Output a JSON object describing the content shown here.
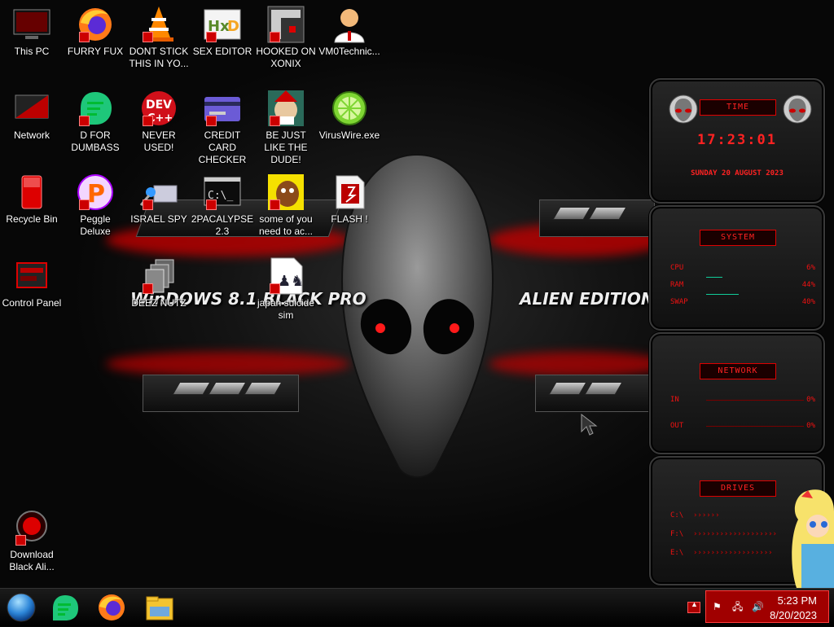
{
  "wallpaper": {
    "left_text": "WinDOWS 8.1 BLACK PRO",
    "right_text": "ALIEN EDITION 20"
  },
  "desktop_icons": [
    {
      "label": "This PC",
      "icon": "computer-icon"
    },
    {
      "label": "FURRY FUX",
      "icon": "firefox-icon"
    },
    {
      "label": "DONT STICK THIS IN YO...",
      "icon": "vlc-cone-icon"
    },
    {
      "label": "SEX EDITOR",
      "icon": "hxd-editor-icon"
    },
    {
      "label": "HOOKED ON XONIX",
      "icon": "xonix-game-icon"
    },
    {
      "label": "VM0Technic...",
      "icon": "technician-avatar-icon"
    },
    {
      "label": "Network",
      "icon": "network-icon"
    },
    {
      "label": "D FOR DUMBASS",
      "icon": "chat-bubble-icon"
    },
    {
      "label": "NEVER USED!",
      "icon": "dev-cpp-icon"
    },
    {
      "label": "CREDIT CARD CHECKER",
      "icon": "credit-card-icon"
    },
    {
      "label": "BE JUST LIKE THE DUDE!",
      "icon": "dude-elf-icon"
    },
    {
      "label": "VirusWire.exe",
      "icon": "lime-icon"
    },
    {
      "label": "Recycle Bin",
      "icon": "recycle-bin-icon"
    },
    {
      "label": "Peggle Deluxe",
      "icon": "peggle-icon"
    },
    {
      "label": "ISRAEL SPY",
      "icon": "spy-glass-icon"
    },
    {
      "label": "2PACALYPSE 2.3",
      "icon": "terminal-icon"
    },
    {
      "label": "some of you need to ac...",
      "icon": "dog-icon"
    },
    {
      "label": "FLASH !",
      "icon": "flash-document-icon"
    },
    {
      "label": "Control Panel",
      "icon": "control-panel-icon"
    },
    {
      "label": "DEEZ NUTZ",
      "icon": "stacked-windows-icon"
    },
    {
      "label": "japan suicide sim",
      "icon": "chess-document-icon"
    },
    {
      "label": "Download Black Ali...",
      "icon": "alien-download-icon"
    }
  ],
  "gadgets": {
    "time": {
      "title": "TIME",
      "time": "17:23:01",
      "date": "SUNDAY 20 AUGUST 2023"
    },
    "system": {
      "title": "SYSTEM",
      "rows": [
        {
          "label": "CPU",
          "value": "6%"
        },
        {
          "label": "RAM",
          "value": "44%"
        },
        {
          "label": "SWAP",
          "value": "40%"
        }
      ]
    },
    "network": {
      "title": "NETWORK",
      "rows": [
        {
          "label": "IN",
          "value": "0%"
        },
        {
          "label": "OUT",
          "value": "0%"
        }
      ]
    },
    "drives": {
      "title": "DRIVES",
      "rows": [
        {
          "label": "C:\\",
          "value": "2("
        },
        {
          "label": "F:\\",
          "value": "1("
        },
        {
          "label": "E:\\",
          "value": "1("
        }
      ]
    }
  },
  "taskbar": {
    "apps": [
      {
        "name": "start-orb",
        "icon": "start-orb-icon"
      },
      {
        "name": "chat-app",
        "icon": "chat-bubble-icon"
      },
      {
        "name": "firefox",
        "icon": "firefox-icon"
      },
      {
        "name": "file-explorer",
        "icon": "folder-icon"
      }
    ],
    "clock_time": "5:23 PM",
    "clock_date": "8/20/2023",
    "tray_icons": [
      "flag-icon",
      "network-icon",
      "speaker-icon"
    ]
  },
  "colors": {
    "accent_red": "#e00000",
    "tray_red": "#a00000"
  }
}
